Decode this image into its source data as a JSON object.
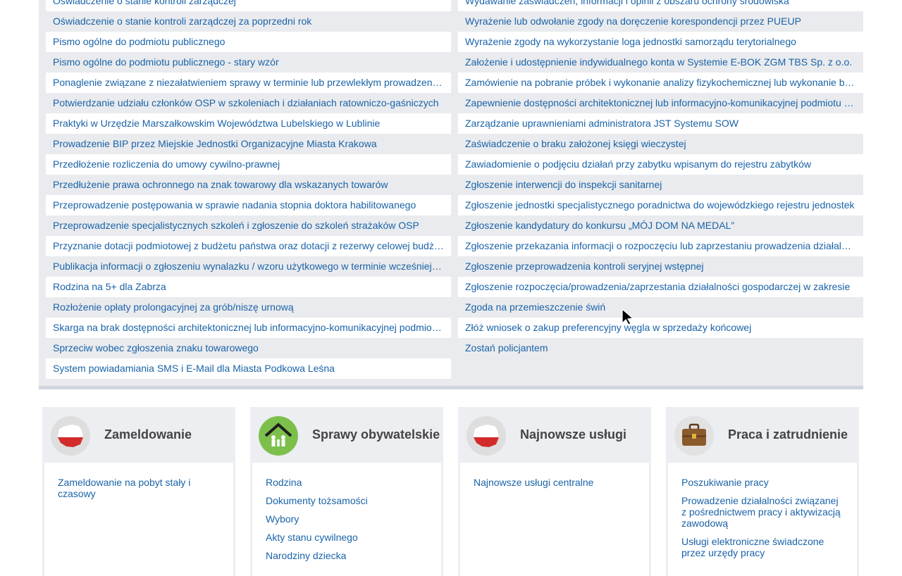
{
  "list": {
    "left": [
      "Oświadczenie o stanie kontroli zarządczej",
      "Oświadczenie o stanie kontroli zarządczej za poprzedni rok",
      "Pismo ogólne do podmiotu publicznego",
      "Pismo ogólne do podmiotu publicznego - stary wzór",
      "Ponaglenie związane z niezałatwieniem sprawy w terminie lub przewlekłym prowadzeniem postępowania",
      "Potwierdzanie udziału członków OSP w szkoleniach i działaniach ratowniczo-gaśniczych",
      "Praktyki w Urzędzie Marszałkowskim Województwa Lubelskiego w Lublinie",
      "Prowadzenie BIP przez Miejskie Jednostki Organizacyjne Miasta Krakowa",
      "Przedłożenie rozliczenia do umowy cywilno-prawnej",
      "Przedłużenie prawa ochronnego na znak towarowy dla wskazanych towarów",
      "Przeprowadzenie postępowania w sprawie nadania stopnia doktora habilitowanego",
      "Przeprowadzenie specjalistycznych szkoleń i zgłoszenie do szkoleń strażaków OSP",
      "Przyznanie dotacji podmiotowej z budżetu państwa oraz dotacji z rezerwy celowej budżetu państwa",
      "Publikacja informacji o zgłoszeniu wynalazku / wzoru użytkowego w terminie wcześniejszym",
      "Rodzina na 5+ dla Zabrza",
      "Rozłożenie opłaty prolongacyjnej za grób/niszę urnową",
      "Skarga na brak dostępności architektonicznej lub informacyjno-komunikacyjnej podmiotu publicznego",
      "Sprzeciw wobec zgłoszenia znaku towarowego",
      "System powiadamiania SMS i E-Mail dla Miasta Podkowa Leśna"
    ],
    "right": [
      "Wydawanie zaświadczeń, informacji i opinii z obszaru ochrony środowiska",
      "Wyrażenie lub odwołanie zgody na doręczenie korespondencji przez PUEUP",
      "Wyrażenie zgody na wykorzystanie loga jednostki samorządu terytorialnego",
      "Założenie i udostępnienie indywidualnego konta w Systemie E-BOK ZGM TBS Sp. z o.o.",
      "Zamówienie na pobranie próbek i wykonanie analizy fizykochemicznej lub wykonanie badań",
      "Zapewnienie dostępności architektonicznej lub informacyjno-komunikacyjnej podmiotu publicznego",
      "Zarządzanie uprawnieniami administratora JST Systemu SOW",
      "Zaświadczenie o braku założonej księgi wieczystej",
      "Zawiadomienie o podjęciu działań przy zabytku wpisanym do rejestru zabytków",
      "Zgłoszenie interwencji do inspekcji sanitarnej",
      "Zgłoszenie jednostki specjalistycznego poradnictwa do wojewódzkiego rejestru jednostek",
      "Zgłoszenie kandydatury do konkursu „MÓJ DOM NA MEDAL”",
      "Zgłoszenie przekazania informacji o rozpoczęciu lub zaprzestaniu prowadzenia działalności",
      "Zgłoszenie przeprowadzenia kontroli seryjnej wstępnej",
      "Zgłoszenie rozpoczęcia/prowadzenia/zaprzestania działalności gospodarczej w zakresie",
      "Zgoda na przemieszczenie świń",
      "Złóż wniosek o zakup preferencyjny węgla w sprzedaży końcowej",
      "Zostań policjantem"
    ]
  },
  "cards": [
    {
      "title": "Zameldowanie",
      "icon": "poland-map-icon",
      "links": [
        "Zameldowanie na pobyt stały i czasowy"
      ]
    },
    {
      "title": "Sprawy obywatelskie",
      "icon": "family-house-icon",
      "links": [
        "Rodzina",
        "Dokumenty tożsamości",
        "Wybory",
        "Akty stanu cywilnego",
        "Narodziny dziecka"
      ]
    },
    {
      "title": "Najnowsze usługi",
      "icon": "poland-map-icon",
      "links": [
        "Najnowsze usługi centralne"
      ]
    },
    {
      "title": "Praca i zatrudnienie",
      "icon": "briefcase-icon",
      "links": [
        "Poszukiwanie pracy",
        "Prowadzenie działalności związanej z pośrednictwem pracy i aktywizacją zawodową",
        "Usługi elektroniczne świadczone przez urzędy pracy"
      ]
    }
  ],
  "colors": {
    "link": "#1a63a8",
    "panel": "#eaebee",
    "title": "#444444"
  }
}
